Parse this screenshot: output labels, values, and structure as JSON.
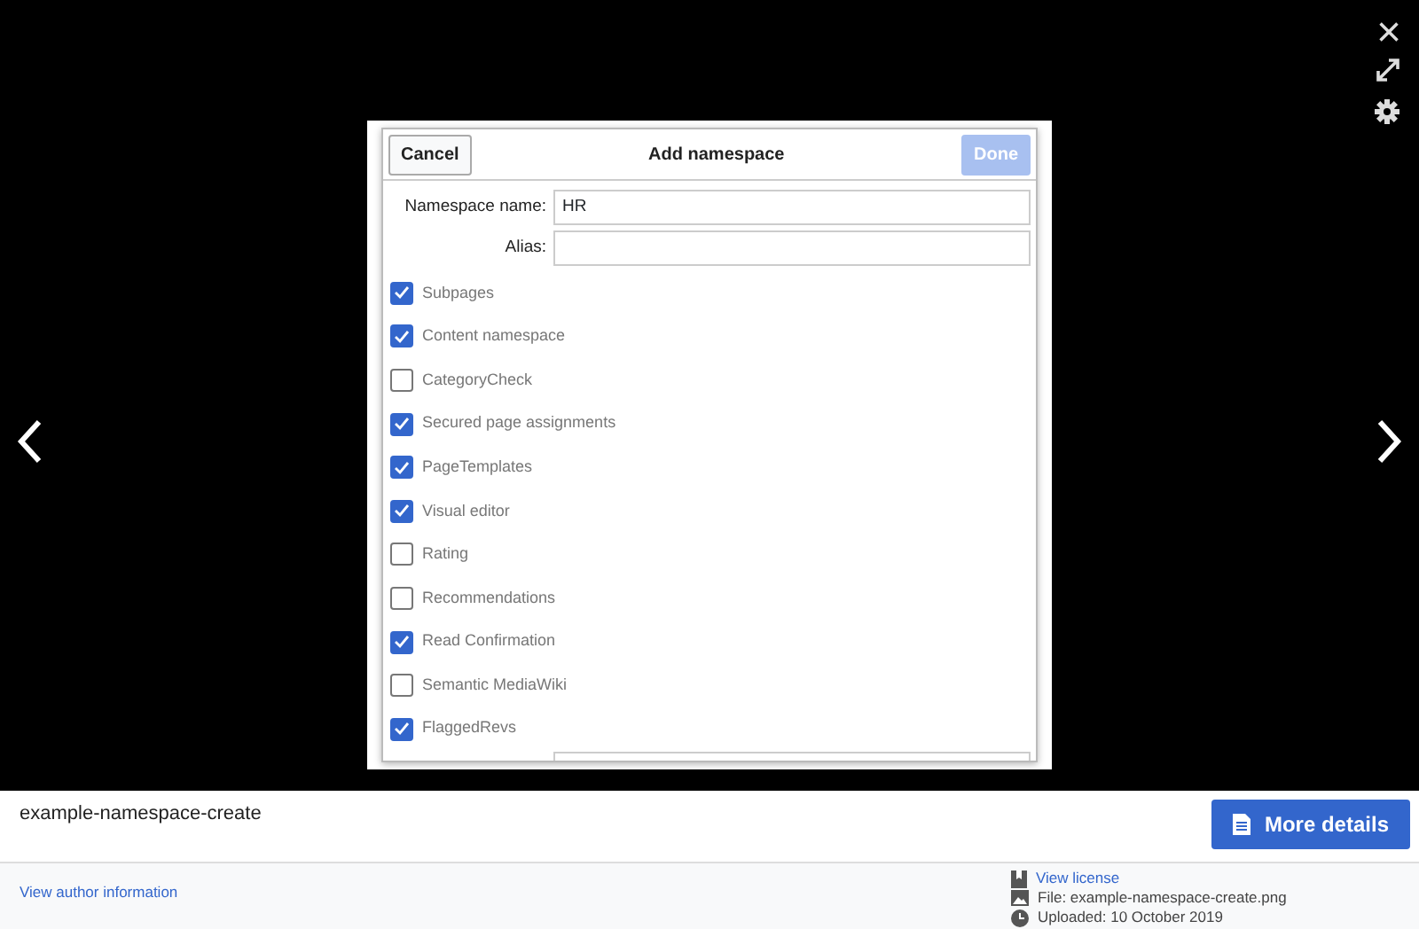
{
  "viewer_controls": {
    "close": "×"
  },
  "dialog": {
    "title": "Add namespace",
    "cancel_button": "Cancel",
    "done_button": "Done",
    "done_disabled": true,
    "fields": [
      {
        "label": "Namespace name:",
        "value": "HR"
      },
      {
        "label": "Alias:"
      }
    ],
    "options": [
      {
        "label": "Subpages",
        "checked": true
      },
      {
        "label": "Content namespace",
        "checked": true
      },
      {
        "label": "CategoryCheck",
        "checked": false
      },
      {
        "label": "Secured page assignments",
        "checked": true
      },
      {
        "label": "PageTemplates",
        "checked": true
      },
      {
        "label": "Visual editor",
        "checked": true
      },
      {
        "label": "Rating",
        "checked": false
      },
      {
        "label": "Recommendations",
        "checked": false
      },
      {
        "label": "Read Confirmation",
        "checked": true
      },
      {
        "label": "Semantic MediaWiki",
        "checked": false
      },
      {
        "label": "FlaggedRevs",
        "checked": true
      }
    ]
  },
  "caption": {
    "title": "example-namespace-create",
    "more_button": "More details"
  },
  "footer": {
    "author_link": "View author information",
    "license_link": "View license",
    "file": "File: example-namespace-create.png",
    "uploaded": "Uploaded: 10 October 2019"
  }
}
